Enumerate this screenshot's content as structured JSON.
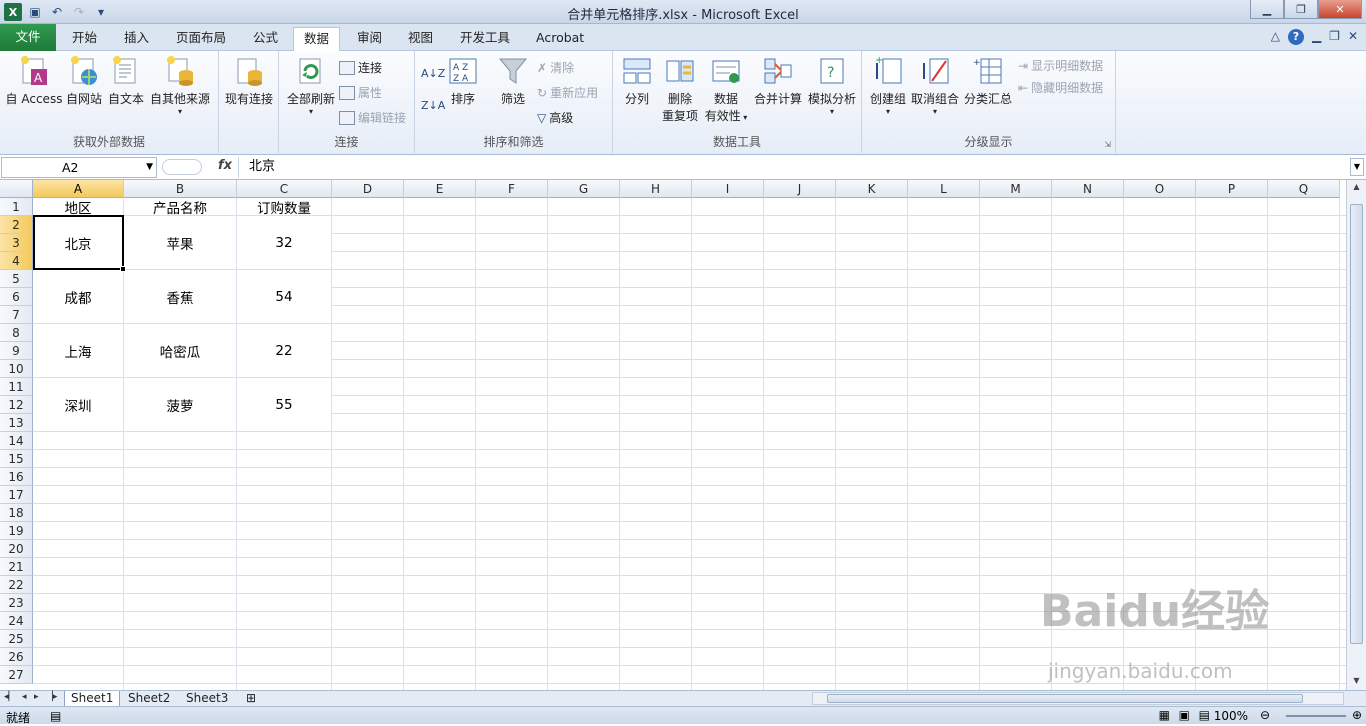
{
  "window": {
    "title": "合并单元格排序.xlsx - Microsoft Excel"
  },
  "tabs": [
    {
      "label": "文件"
    },
    {
      "label": "开始"
    },
    {
      "label": "插入"
    },
    {
      "label": "页面布局"
    },
    {
      "label": "公式"
    },
    {
      "label": "数据"
    },
    {
      "label": "审阅"
    },
    {
      "label": "视图"
    },
    {
      "label": "开发工具"
    },
    {
      "label": "Acrobat"
    }
  ],
  "ribbon": {
    "get_external": {
      "label": "获取外部数据",
      "access": "自 Access",
      "web": "自网站",
      "text": "自文本",
      "other": "自其他来源",
      "existing": "现有连接"
    },
    "connections": {
      "label": "连接",
      "refresh_all": "全部刷新",
      "connections": "连接",
      "properties": "属性",
      "edit_links": "编辑链接"
    },
    "sort_filter": {
      "label": "排序和筛选",
      "sort": "排序",
      "filter": "筛选",
      "clear": "清除",
      "reapply": "重新应用",
      "advanced": "高级"
    },
    "data_tools": {
      "label": "数据工具",
      "text_to_columns": "分列",
      "remove_dup1": "删除",
      "remove_dup2": "重复项",
      "validation1": "数据",
      "validation2": "有效性",
      "consolidate": "合并计算",
      "whatif": "模拟分析"
    },
    "outline": {
      "label": "分级显示",
      "group": "创建组",
      "ungroup": "取消组合",
      "subtotal": "分类汇总",
      "show_detail": "显示明细数据",
      "hide_detail": "隐藏明细数据"
    }
  },
  "formula_bar": {
    "name_box": "A2",
    "fx": "fx",
    "content": "北京"
  },
  "columns": [
    "A",
    "B",
    "C",
    "D",
    "E",
    "F",
    "G",
    "H",
    "I",
    "J",
    "K",
    "L",
    "M",
    "N",
    "O",
    "P",
    "Q"
  ],
  "rows": [
    "1",
    "2",
    "3",
    "4",
    "5",
    "6",
    "7",
    "8",
    "9",
    "10",
    "11",
    "12",
    "13",
    "14",
    "15",
    "16",
    "17",
    "18",
    "19",
    "20",
    "21",
    "22",
    "23",
    "24",
    "25",
    "26",
    "27"
  ],
  "cells": {
    "headers": [
      "地区",
      "产品名称",
      "订购数量"
    ],
    "data": [
      [
        "北京",
        "苹果",
        "32"
      ],
      [
        "成都",
        "香蕉",
        "54"
      ],
      [
        "上海",
        "哈密瓜",
        "22"
      ],
      [
        "深圳",
        "菠萝",
        "55"
      ]
    ]
  },
  "sheets": [
    "Sheet1",
    "Sheet2",
    "Sheet3"
  ],
  "status": {
    "mode": "就绪",
    "zoom": "100%"
  },
  "watermark": {
    "main": "Baidu经验",
    "sub": "jingyan.baidu.com"
  }
}
